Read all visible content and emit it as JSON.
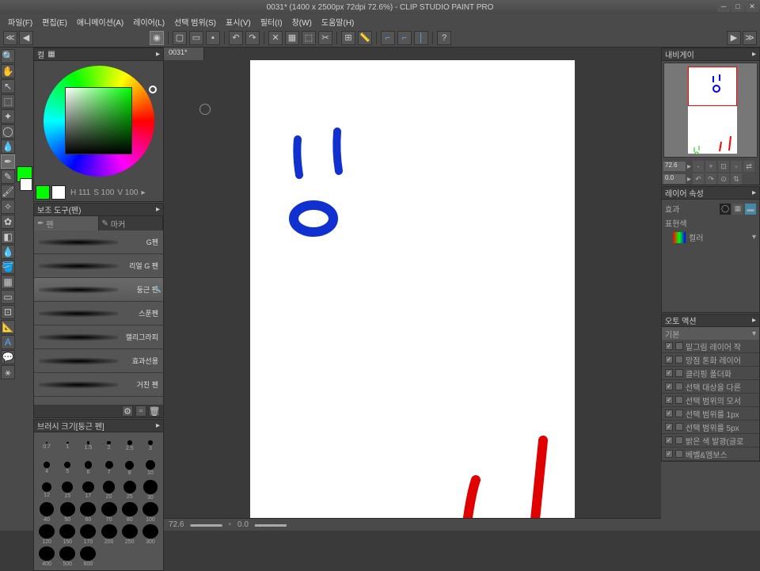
{
  "title": "0031* (1400 x 2500px 72dpi 72.6%)  - CLIP STUDIO PAINT PRO",
  "menu": [
    "파일(F)",
    "편집(E)",
    "애니메이션(A)",
    "레이어(L)",
    "선택 범위(S)",
    "표시(V)",
    "필터(I)",
    "창(W)",
    "도움말(H)"
  ],
  "doc_tab": "0031*",
  "hsv": {
    "h": "H 111",
    "s": "S 100",
    "v": "V 100"
  },
  "color_tab": "컬",
  "subtool_header": "보조 도구(펜)",
  "subtool": {
    "pen": "펜",
    "marker": "마커"
  },
  "brushes": [
    "G펜",
    "리얼 G 펜",
    "둥근 펜",
    "스푼펜",
    "캘리그라피",
    "효과선용",
    "거친 펜"
  ],
  "brush_size_header": "브러시 크기[둥근 펜]",
  "sizes": [
    "0.7",
    "1",
    "1.5",
    "2",
    "2.5",
    "3",
    "4",
    "5",
    "6",
    "7",
    "8",
    "10",
    "12",
    "15",
    "17",
    "20",
    "25",
    "30",
    "40",
    "50",
    "60",
    "70",
    "80",
    "100",
    "120",
    "150",
    "170",
    "200",
    "250",
    "300",
    "400",
    "500",
    "600"
  ],
  "nav": {
    "zoom": "72.6",
    "angle": "0.0",
    "tab": "내비게이"
  },
  "layer_props": {
    "tab": "레이어 속성",
    "effect": "효과",
    "expr": "표현색",
    "color": "컬러"
  },
  "actions": {
    "tab": "오토 액션",
    "set": "기본",
    "items": [
      "밑그림 레이어 작",
      "망점 톤화 레이어",
      "클리핑 폴더화",
      "선택 대상을 다른",
      "선택 범위의 모서",
      "선택 범위를 1px",
      "선택 범위를 5px",
      "밝은 색 발광(글로",
      "베벨&엠보스"
    ]
  },
  "status": {
    "zoom": "72.6",
    "pos": "0.0"
  }
}
